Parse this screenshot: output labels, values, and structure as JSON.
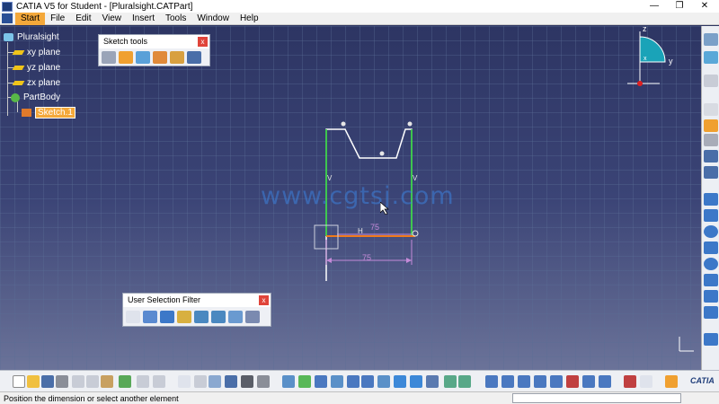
{
  "window": {
    "title": "CATIA V5 for Student - [Pluralsight.CATPart]",
    "min_glyph": "—",
    "max_glyph": "❐",
    "close_glyph": "✕"
  },
  "menu": {
    "items": [
      {
        "label": "Start",
        "active": true
      },
      {
        "label": "File"
      },
      {
        "label": "Edit"
      },
      {
        "label": "View"
      },
      {
        "label": "Insert"
      },
      {
        "label": "Tools"
      },
      {
        "label": "Window"
      },
      {
        "label": "Help"
      }
    ]
  },
  "tree": {
    "root": "Pluralsight",
    "xy_plane": "xy plane",
    "yz_plane": "yz plane",
    "zx_plane": "zx plane",
    "partbody": "PartBody",
    "sketch": "Sketch.1"
  },
  "sketch_tools": {
    "title": "Sketch tools",
    "close": "x"
  },
  "selection_filter": {
    "title": "User Selection Filter",
    "close": "x"
  },
  "sketch": {
    "dim_horizontal": "75",
    "dim_overall": "75",
    "constraint_h": "H",
    "constraint_v_left": "V",
    "constraint_v_right": "V"
  },
  "compass": {
    "z_label": "z",
    "y_label": "y",
    "x_label": "x"
  },
  "watermark": "www.cgtsj.com",
  "status": {
    "message": "Position the dimension or select another element"
  },
  "brand": {
    "logo_text": "CATIA",
    "accent": "#f4a83a",
    "sketch_green": "#1fd12c",
    "dimension_purple": "#c48ad8",
    "construction_orange": "#f07a1a"
  },
  "icons": {
    "canvas_axis": "xy-axis-icon",
    "cursor": "arrow-cursor-icon"
  }
}
